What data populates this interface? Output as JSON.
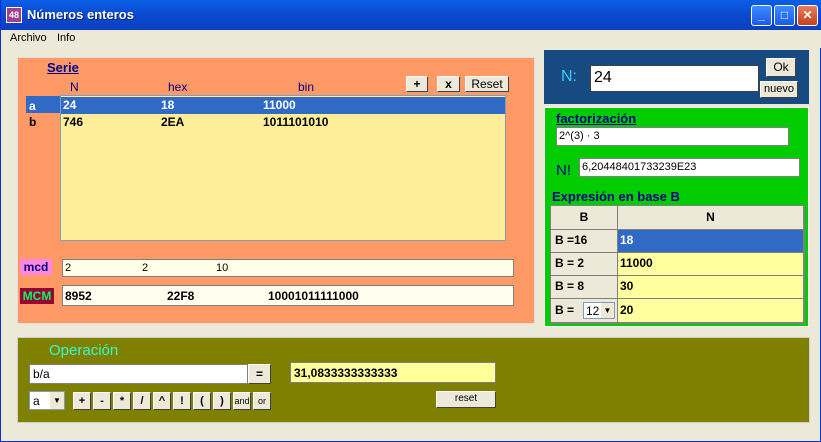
{
  "window": {
    "title": "Números enteros",
    "icon_text": "48",
    "buttons": {
      "minimize": "_",
      "maximize": "□",
      "close": "✕"
    }
  },
  "menu": {
    "items": [
      "Archivo",
      "Info"
    ]
  },
  "serie": {
    "title": "Serie",
    "headers": {
      "n": "N",
      "hex": "hex",
      "bin": "bin"
    },
    "buttons": {
      "add": "+",
      "remove": "x",
      "reset": "Reset"
    },
    "row_labels": [
      "a",
      "b"
    ],
    "rows": [
      {
        "n": "24",
        "hex": "18",
        "bin": "11000"
      },
      {
        "n": "746",
        "hex": "2EA",
        "bin": "1011101010"
      }
    ],
    "mcd": {
      "label": "mcd",
      "n": "2",
      "hex": "2",
      "bin": "10"
    },
    "mcm": {
      "label": "MCM",
      "n": "8952",
      "hex": "22F8",
      "bin": "10001011111000"
    }
  },
  "n_panel": {
    "label": "N:",
    "value": "24",
    "ok_label": "Ok",
    "nuevo_label": "nuevo"
  },
  "factor": {
    "title": "factorización",
    "value": "2^(3) · 3",
    "nfact_label": "N!",
    "nfact_value": "6,20448401733239E23",
    "base_title": "Expresión en base B",
    "col_b": "B",
    "col_n": "N",
    "rows": [
      {
        "b": "B =16",
        "n": "18"
      },
      {
        "b": "B = 2",
        "n": "11000"
      },
      {
        "b": "B = 8",
        "n": "30"
      },
      {
        "b": "B =",
        "n": "20"
      }
    ],
    "base_select": "12"
  },
  "operation": {
    "title": "Operación",
    "expression": "b/a",
    "equals_label": "=",
    "result": "31,0833333333333",
    "var_select": "a",
    "op_buttons": [
      "+",
      "-",
      "*",
      "/",
      "^",
      "!",
      "(",
      ")",
      "and",
      "or"
    ],
    "reset_label": "reset"
  },
  "colors": {
    "serie_bg": "#ff9966",
    "list_bg": "#ffee99",
    "selection": "#316ac5",
    "n_panel_bg": "#174a80",
    "factor_bg": "#00cc00",
    "operation_bg": "#808000",
    "title_cyan": "#33ffcc",
    "mcd_bg": "#ff88dd",
    "mcm_bg": "#990033",
    "mcm_text": "#00ff66"
  }
}
